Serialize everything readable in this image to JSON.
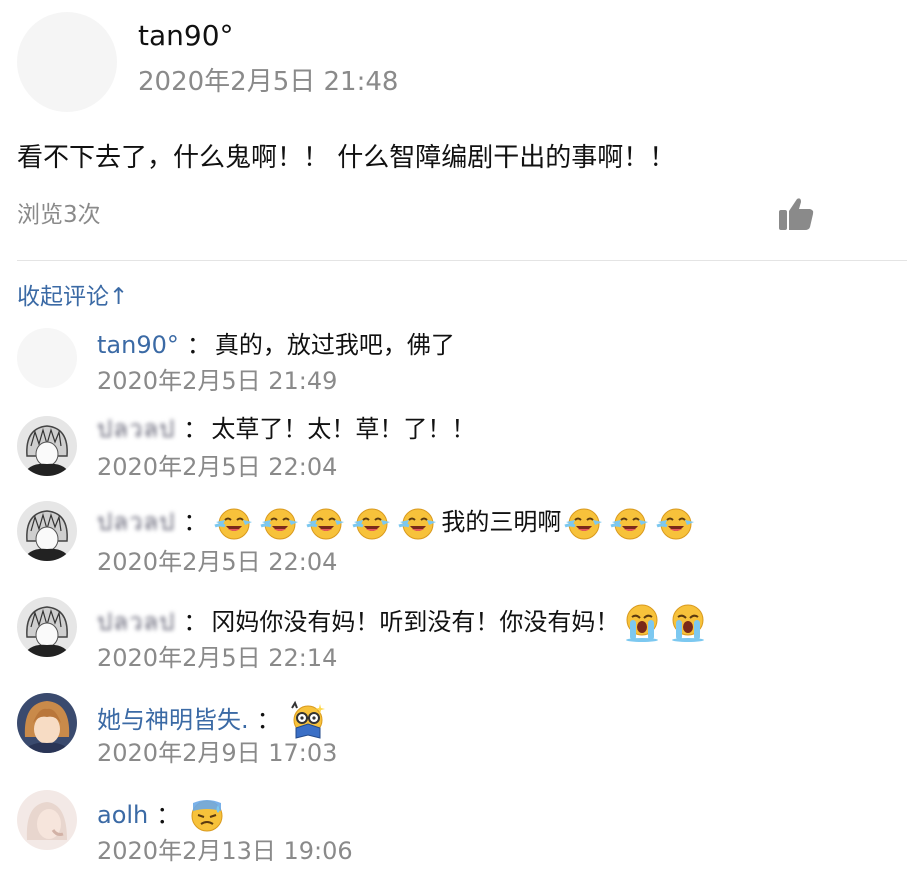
{
  "post": {
    "username": "tan90°",
    "timestamp": "2020年2月5日 21:48",
    "content": "看不下去了，什么鬼啊！！ 什么智障编剧干出的事啊！！",
    "views": "浏览3次"
  },
  "comments_toggle": "收起评论↑",
  "separator": "：",
  "comments": [
    {
      "username": "tan90°",
      "text_before": "真的，放过我吧，佛了",
      "text_after": "",
      "timestamp": "2020年2月5日 21:49"
    },
    {
      "username": "ปลวลป",
      "text_before": "太草了！太！草！了！！",
      "text_after": "",
      "timestamp": "2020年2月5日 22:04"
    },
    {
      "username": "ปลวลป",
      "text_before": "",
      "text_after": "我的三明啊",
      "timestamp": "2020年2月5日 22:04"
    },
    {
      "username": "ปลวลป",
      "text_before": "冈妈你没有妈！听到没有！你没有妈！",
      "text_after": "",
      "timestamp": "2020年2月5日 22:14"
    },
    {
      "username": "她与神明皆失.",
      "text_before": "",
      "text_after": "",
      "timestamp": "2020年2月9日 17:03"
    },
    {
      "username": "aolh",
      "text_before": "",
      "text_after": "",
      "timestamp": "2020年2月13日 19:06"
    }
  ],
  "icons": {
    "like": "thumbs-up-icon",
    "laugh_cry": "laughing-crying-emoji",
    "loud_cry": "loudly-crying-emoji",
    "nerd": "nerd-reading-emoji",
    "sweat": "cold-sweat-emoji"
  },
  "colors": {
    "link": "#3b6aa5",
    "muted": "#8a8a8a",
    "text": "#111111",
    "emoji_yellow": "#f7c23b",
    "tear_blue": "#7cc8f0"
  }
}
